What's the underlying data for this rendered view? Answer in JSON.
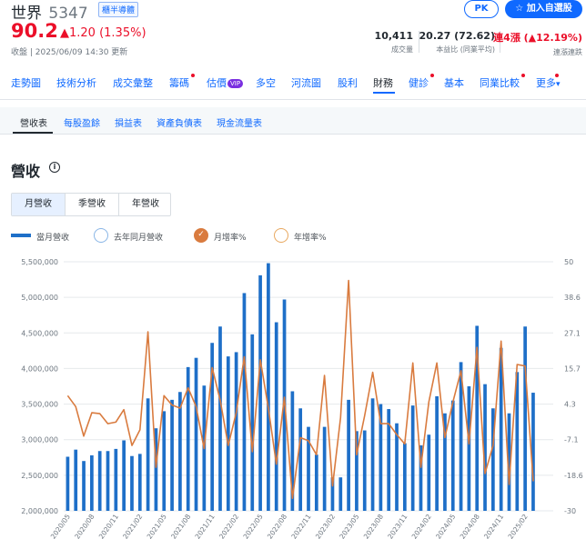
{
  "header": {
    "name": "世界",
    "code": "5347",
    "tag": "櫃半導體",
    "price": "90.2",
    "change": "▲1.20 (1.35%)",
    "close_note": "收盤 | 2025/06/09 14:30 更新",
    "pk_label": "PK",
    "watch_label": "☆ 加入自選股"
  },
  "stats": [
    {
      "value": "10,411",
      "label": "成交量"
    },
    {
      "value": "20.27 (72.62)",
      "label": "本益比 (同業平均)"
    },
    {
      "value": "連4漲 (▲12.19%)",
      "label": "連漲連跌"
    }
  ],
  "nav": {
    "items": [
      {
        "label": "走勢圖"
      },
      {
        "label": "技術分析"
      },
      {
        "label": "成交彙整"
      },
      {
        "label": "籌碼"
      },
      {
        "label": "估價"
      },
      {
        "label": "多空"
      },
      {
        "label": "河流圖"
      },
      {
        "label": "股利"
      },
      {
        "label": "財務"
      },
      {
        "label": "健診"
      },
      {
        "label": "基本"
      },
      {
        "label": "同業比較"
      },
      {
        "label": "更多"
      }
    ],
    "vip": "VIP",
    "active": "財務"
  },
  "sub_tabs": [
    {
      "label": "營收表"
    },
    {
      "label": "每股盈餘"
    },
    {
      "label": "損益表"
    },
    {
      "label": "資產負債表"
    },
    {
      "label": "現金流量表"
    }
  ],
  "section": {
    "title": "營收",
    "info": "i"
  },
  "period": [
    {
      "label": "月營收"
    },
    {
      "label": "季營收"
    },
    {
      "label": "年營收"
    }
  ],
  "legend": [
    {
      "label": "當月營收"
    },
    {
      "label": "去年同月營收"
    },
    {
      "label": "月增率%"
    },
    {
      "label": "年增率%"
    }
  ],
  "colors": {
    "up": "#eb0f29",
    "accent": "#0f69ff",
    "bar": "#1e6fc8",
    "line": "#d97b3f"
  },
  "chart_data": {
    "type": "bar",
    "x": [
      "2020/05",
      "2020/06",
      "2020/07",
      "2020/08",
      "2020/09",
      "2020/10",
      "2020/11",
      "2020/12",
      "2021/01",
      "2021/02",
      "2021/03",
      "2021/04",
      "2021/05",
      "2021/06",
      "2021/07",
      "2021/08",
      "2021/09",
      "2021/10",
      "2021/11",
      "2021/12",
      "2022/01",
      "2022/02",
      "2022/03",
      "2022/04",
      "2022/05",
      "2022/06",
      "2022/07",
      "2022/08",
      "2022/09",
      "2022/10",
      "2022/11",
      "2022/12",
      "2023/01",
      "2023/02",
      "2023/03",
      "2023/04",
      "2023/05",
      "2023/06",
      "2023/07",
      "2023/08",
      "2023/09",
      "2023/10",
      "2023/11",
      "2023/12",
      "2024/01",
      "2024/02",
      "2024/03",
      "2024/04",
      "2024/05",
      "2024/06",
      "2024/07",
      "2024/08",
      "2024/09",
      "2024/10",
      "2024/11",
      "2024/12",
      "2025/01",
      "2025/02",
      "2025/03",
      "2025/04",
      "2025/05"
    ],
    "x_tick_labels": [
      "2020/05",
      "2020/08",
      "2020/11",
      "2021/02",
      "2021/05",
      "2021/08",
      "2021/11",
      "2022/02",
      "2022/05",
      "2022/08",
      "2022/11",
      "2023/02",
      "2023/05",
      "2023/08",
      "2023/11",
      "2024/02",
      "2024/05",
      "2024/08",
      "2024/11",
      "2025/02"
    ],
    "series": [
      {
        "name": "當月營收",
        "axis": "left",
        "values": [
          2760000,
          2860000,
          2700000,
          2780000,
          2840000,
          2840000,
          2870000,
          2990000,
          2770000,
          2800000,
          3580000,
          3160000,
          3400000,
          3560000,
          3670000,
          4020000,
          4150000,
          3760000,
          4360000,
          4590000,
          4170000,
          4230000,
          5060000,
          4480000,
          5310000,
          5480000,
          4650000,
          4970000,
          3680000,
          3440000,
          3180000,
          2790000,
          3180000,
          2470000,
          2470000,
          3560000,
          3120000,
          3130000,
          3580000,
          3500000,
          3430000,
          3230000,
          2950000,
          3480000,
          2920000,
          3070000,
          3610000,
          3370000,
          3550000,
          4090000,
          3750000,
          4600000,
          3780000,
          3440000,
          4290000,
          3370000,
          3950000,
          4590000,
          3660000
        ]
      },
      {
        "name": "月增率%",
        "axis": "right",
        "values": [
          7.0,
          3.5,
          -6.0,
          1.5,
          1.2,
          -2.0,
          -1.5,
          2.5,
          -9.0,
          -4.0,
          27.5,
          -16.0,
          7.0,
          4.0,
          3.0,
          9.5,
          3.5,
          -10.0,
          16.0,
          5.5,
          -9.0,
          1.5,
          19.5,
          -11.0,
          18.5,
          3.0,
          -15.0,
          6.5,
          -26.0,
          -6.5,
          -7.5,
          -12.0,
          13.5,
          -22.0,
          0.0,
          44.0,
          -12.0,
          0.5,
          14.5,
          -2.0,
          -2.0,
          -5.5,
          -8.5,
          17.5,
          -16.0,
          5.0,
          17.5,
          -6.5,
          5.0,
          15.0,
          -8.5,
          22.5,
          -18.0,
          -9.0,
          24.5,
          -21.5,
          17.0,
          16.5,
          -20.5
        ]
      }
    ],
    "ylim": [
      2000000,
      5500000
    ],
    "y_ticks": [
      "5,500,000",
      "5,000,000",
      "4,500,000",
      "4,000,000",
      "3,500,000",
      "3,000,000",
      "2,500,000",
      "2,000,000"
    ],
    "y2lim": [
      -30,
      50
    ],
    "y2_ticks": [
      "50",
      "38.6",
      "27.1",
      "15.7",
      "4.3",
      "-7.1",
      "-18.6",
      "-30"
    ],
    "grid": true
  }
}
